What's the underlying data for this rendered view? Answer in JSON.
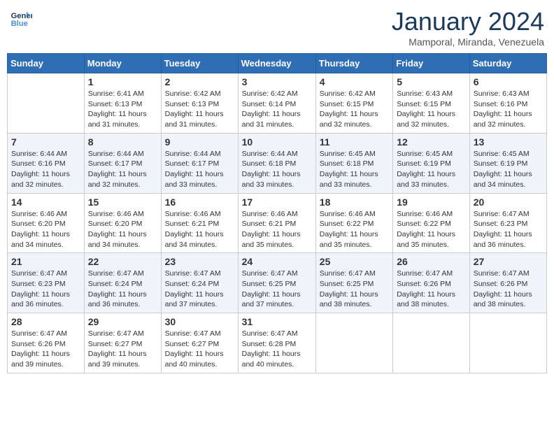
{
  "header": {
    "logo_line1": "General",
    "logo_line2": "Blue",
    "month_title": "January 2024",
    "location": "Mamporal, Miranda, Venezuela"
  },
  "weekdays": [
    "Sunday",
    "Monday",
    "Tuesday",
    "Wednesday",
    "Thursday",
    "Friday",
    "Saturday"
  ],
  "weeks": [
    [
      {
        "day": "",
        "sunrise": "",
        "sunset": "",
        "daylight": ""
      },
      {
        "day": "1",
        "sunrise": "Sunrise: 6:41 AM",
        "sunset": "Sunset: 6:13 PM",
        "daylight": "Daylight: 11 hours and 31 minutes."
      },
      {
        "day": "2",
        "sunrise": "Sunrise: 6:42 AM",
        "sunset": "Sunset: 6:13 PM",
        "daylight": "Daylight: 11 hours and 31 minutes."
      },
      {
        "day": "3",
        "sunrise": "Sunrise: 6:42 AM",
        "sunset": "Sunset: 6:14 PM",
        "daylight": "Daylight: 11 hours and 31 minutes."
      },
      {
        "day": "4",
        "sunrise": "Sunrise: 6:42 AM",
        "sunset": "Sunset: 6:15 PM",
        "daylight": "Daylight: 11 hours and 32 minutes."
      },
      {
        "day": "5",
        "sunrise": "Sunrise: 6:43 AM",
        "sunset": "Sunset: 6:15 PM",
        "daylight": "Daylight: 11 hours and 32 minutes."
      },
      {
        "day": "6",
        "sunrise": "Sunrise: 6:43 AM",
        "sunset": "Sunset: 6:16 PM",
        "daylight": "Daylight: 11 hours and 32 minutes."
      }
    ],
    [
      {
        "day": "7",
        "sunrise": "Sunrise: 6:44 AM",
        "sunset": "Sunset: 6:16 PM",
        "daylight": "Daylight: 11 hours and 32 minutes."
      },
      {
        "day": "8",
        "sunrise": "Sunrise: 6:44 AM",
        "sunset": "Sunset: 6:17 PM",
        "daylight": "Daylight: 11 hours and 32 minutes."
      },
      {
        "day": "9",
        "sunrise": "Sunrise: 6:44 AM",
        "sunset": "Sunset: 6:17 PM",
        "daylight": "Daylight: 11 hours and 33 minutes."
      },
      {
        "day": "10",
        "sunrise": "Sunrise: 6:44 AM",
        "sunset": "Sunset: 6:18 PM",
        "daylight": "Daylight: 11 hours and 33 minutes."
      },
      {
        "day": "11",
        "sunrise": "Sunrise: 6:45 AM",
        "sunset": "Sunset: 6:18 PM",
        "daylight": "Daylight: 11 hours and 33 minutes."
      },
      {
        "day": "12",
        "sunrise": "Sunrise: 6:45 AM",
        "sunset": "Sunset: 6:19 PM",
        "daylight": "Daylight: 11 hours and 33 minutes."
      },
      {
        "day": "13",
        "sunrise": "Sunrise: 6:45 AM",
        "sunset": "Sunset: 6:19 PM",
        "daylight": "Daylight: 11 hours and 34 minutes."
      }
    ],
    [
      {
        "day": "14",
        "sunrise": "Sunrise: 6:46 AM",
        "sunset": "Sunset: 6:20 PM",
        "daylight": "Daylight: 11 hours and 34 minutes."
      },
      {
        "day": "15",
        "sunrise": "Sunrise: 6:46 AM",
        "sunset": "Sunset: 6:20 PM",
        "daylight": "Daylight: 11 hours and 34 minutes."
      },
      {
        "day": "16",
        "sunrise": "Sunrise: 6:46 AM",
        "sunset": "Sunset: 6:21 PM",
        "daylight": "Daylight: 11 hours and 34 minutes."
      },
      {
        "day": "17",
        "sunrise": "Sunrise: 6:46 AM",
        "sunset": "Sunset: 6:21 PM",
        "daylight": "Daylight: 11 hours and 35 minutes."
      },
      {
        "day": "18",
        "sunrise": "Sunrise: 6:46 AM",
        "sunset": "Sunset: 6:22 PM",
        "daylight": "Daylight: 11 hours and 35 minutes."
      },
      {
        "day": "19",
        "sunrise": "Sunrise: 6:46 AM",
        "sunset": "Sunset: 6:22 PM",
        "daylight": "Daylight: 11 hours and 35 minutes."
      },
      {
        "day": "20",
        "sunrise": "Sunrise: 6:47 AM",
        "sunset": "Sunset: 6:23 PM",
        "daylight": "Daylight: 11 hours and 36 minutes."
      }
    ],
    [
      {
        "day": "21",
        "sunrise": "Sunrise: 6:47 AM",
        "sunset": "Sunset: 6:23 PM",
        "daylight": "Daylight: 11 hours and 36 minutes."
      },
      {
        "day": "22",
        "sunrise": "Sunrise: 6:47 AM",
        "sunset": "Sunset: 6:24 PM",
        "daylight": "Daylight: 11 hours and 36 minutes."
      },
      {
        "day": "23",
        "sunrise": "Sunrise: 6:47 AM",
        "sunset": "Sunset: 6:24 PM",
        "daylight": "Daylight: 11 hours and 37 minutes."
      },
      {
        "day": "24",
        "sunrise": "Sunrise: 6:47 AM",
        "sunset": "Sunset: 6:25 PM",
        "daylight": "Daylight: 11 hours and 37 minutes."
      },
      {
        "day": "25",
        "sunrise": "Sunrise: 6:47 AM",
        "sunset": "Sunset: 6:25 PM",
        "daylight": "Daylight: 11 hours and 38 minutes."
      },
      {
        "day": "26",
        "sunrise": "Sunrise: 6:47 AM",
        "sunset": "Sunset: 6:26 PM",
        "daylight": "Daylight: 11 hours and 38 minutes."
      },
      {
        "day": "27",
        "sunrise": "Sunrise: 6:47 AM",
        "sunset": "Sunset: 6:26 PM",
        "daylight": "Daylight: 11 hours and 38 minutes."
      }
    ],
    [
      {
        "day": "28",
        "sunrise": "Sunrise: 6:47 AM",
        "sunset": "Sunset: 6:26 PM",
        "daylight": "Daylight: 11 hours and 39 minutes."
      },
      {
        "day": "29",
        "sunrise": "Sunrise: 6:47 AM",
        "sunset": "Sunset: 6:27 PM",
        "daylight": "Daylight: 11 hours and 39 minutes."
      },
      {
        "day": "30",
        "sunrise": "Sunrise: 6:47 AM",
        "sunset": "Sunset: 6:27 PM",
        "daylight": "Daylight: 11 hours and 40 minutes."
      },
      {
        "day": "31",
        "sunrise": "Sunrise: 6:47 AM",
        "sunset": "Sunset: 6:28 PM",
        "daylight": "Daylight: 11 hours and 40 minutes."
      },
      {
        "day": "",
        "sunrise": "",
        "sunset": "",
        "daylight": ""
      },
      {
        "day": "",
        "sunrise": "",
        "sunset": "",
        "daylight": ""
      },
      {
        "day": "",
        "sunrise": "",
        "sunset": "",
        "daylight": ""
      }
    ]
  ]
}
